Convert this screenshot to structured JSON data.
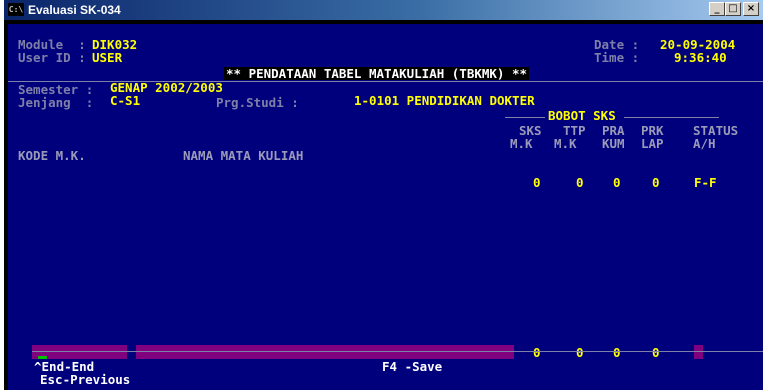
{
  "window": {
    "icon": "C:\\",
    "title": "Evaluasi SK-034",
    "controls": {
      "minimize": "_",
      "restore": "□",
      "close": "×"
    }
  },
  "header": {
    "module_label": "Module  :",
    "module_value": "DIK032",
    "userid_label": "User ID :",
    "userid_value": "USER",
    "date_label": "Date :",
    "date_value": "20-09-2004",
    "time_label": "Time :",
    "time_value": "9:36:40",
    "heading": "** PENDATAAN TABEL MATAKULIAH (TBKMK) **"
  },
  "info": {
    "semester_label": "Semester :",
    "semester_value": "GENAP 2002/2003",
    "jenjang_label": "Jenjang  :",
    "jenjang_value": "C-S1",
    "prodi_label": "Prg.Studi :",
    "prodi_value": "1-0101 PENDIDIKAN DOKTER"
  },
  "columns": {
    "bobot_group": "BOBOT SKS",
    "kode": "KODE M.K.",
    "nama": "NAMA MATA KULIAH",
    "sks_top": "SKS",
    "sks_bottom": "M.K",
    "ttp_top": "TTP",
    "ttp_bottom": "M.K",
    "pra_top": "PRA",
    "pra_bottom": "KUM",
    "prk_top": "PRK",
    "prk_bottom": "LAP",
    "status_top": "STATUS",
    "status_bottom": "A/H"
  },
  "totals_row": {
    "sks": "0",
    "ttp": "0",
    "pra": "0",
    "prk": "0",
    "status": "F-F"
  },
  "edit_row": {
    "sks": "0",
    "ttp": "0",
    "pra": "0",
    "prk": "0"
  },
  "footer": {
    "end": "^End-End",
    "esc": "Esc-Previous",
    "save": "F4 -Save"
  }
}
